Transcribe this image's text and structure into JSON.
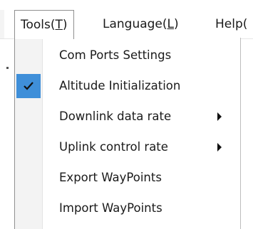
{
  "menubar": {
    "tools": {
      "text": "Tools(",
      "mnemonic": "T",
      "close": ")"
    },
    "language": {
      "text": "Language(",
      "mnemonic": "L",
      "close": ")"
    },
    "help": {
      "text": "Help("
    }
  },
  "tools_menu": {
    "items": [
      {
        "label": "Com Ports Settings",
        "checked": false,
        "submenu": false
      },
      {
        "label": "Altitude Initialization",
        "checked": true,
        "submenu": false
      },
      {
        "label": "Downlink data rate",
        "checked": false,
        "submenu": true
      },
      {
        "label": "Uplink control rate",
        "checked": false,
        "submenu": true
      },
      {
        "label": "Export WayPoints",
        "checked": false,
        "submenu": false
      },
      {
        "label": "Import WayPoints",
        "checked": false,
        "submenu": false
      }
    ]
  },
  "colors": {
    "check_highlight": "#3f8fd9",
    "icon_column": "#f3f3f3"
  },
  "icons": {
    "check": "check-icon",
    "submenu": "submenu-arrow-icon"
  }
}
